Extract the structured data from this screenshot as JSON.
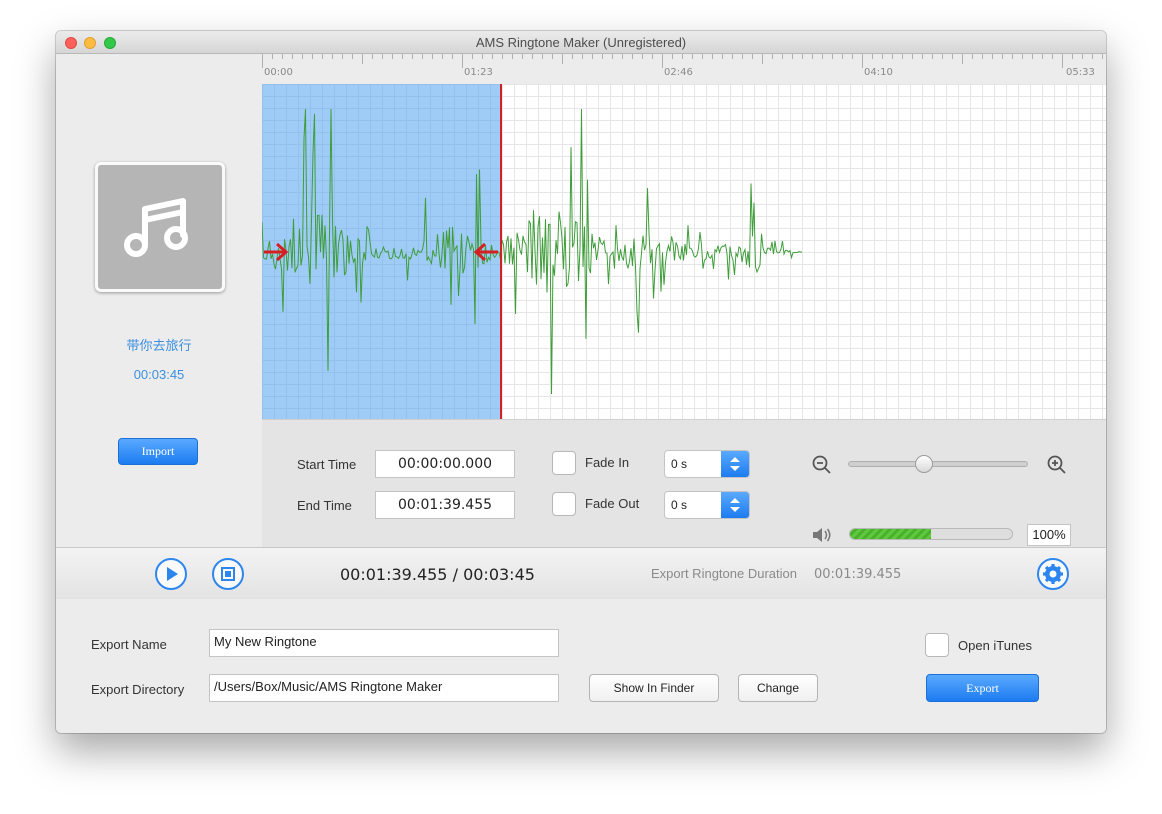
{
  "window": {
    "title": "AMS Ringtone Maker (Unregistered)"
  },
  "left": {
    "album_icon": "music-note-icon",
    "song_title": "带你去旅行",
    "song_duration": "00:03:45",
    "import_label": "Import"
  },
  "ruler": {
    "labels": [
      "00:00",
      "01:23",
      "02:46",
      "04:10",
      "05:33"
    ]
  },
  "controls": {
    "start_time_label": "Start Time",
    "start_time_value": "00:00:00.000",
    "end_time_label": "End Time",
    "end_time_value": "00:01:39.455",
    "fade_in_label": "Fade In",
    "fade_in_value": "0 s",
    "fade_out_label": "Fade Out",
    "fade_out_value": "0 s",
    "zoom_level": 0.42,
    "volume_fraction": 0.5,
    "volume_percent": "100%"
  },
  "transport": {
    "current_time": "00:01:39.455",
    "separator": "/",
    "total_time": "00:03:45",
    "export_duration_label": "Export Ringtone Duration",
    "export_duration_value": "00:01:39.455"
  },
  "export": {
    "name_label": "Export Name",
    "name_value": "My New Ringtone",
    "directory_label": "Export Directory",
    "directory_value": "/Users/Box/Music/AMS Ringtone Maker",
    "show_in_finder_label": "Show In Finder",
    "change_label": "Change",
    "open_itunes_label": "Open iTunes",
    "export_label": "Export"
  },
  "colors": {
    "accent": "#1c7cf0",
    "waveform": "#3f9d3a",
    "selection": "#6fb1f2",
    "playhead": "#d42020"
  }
}
